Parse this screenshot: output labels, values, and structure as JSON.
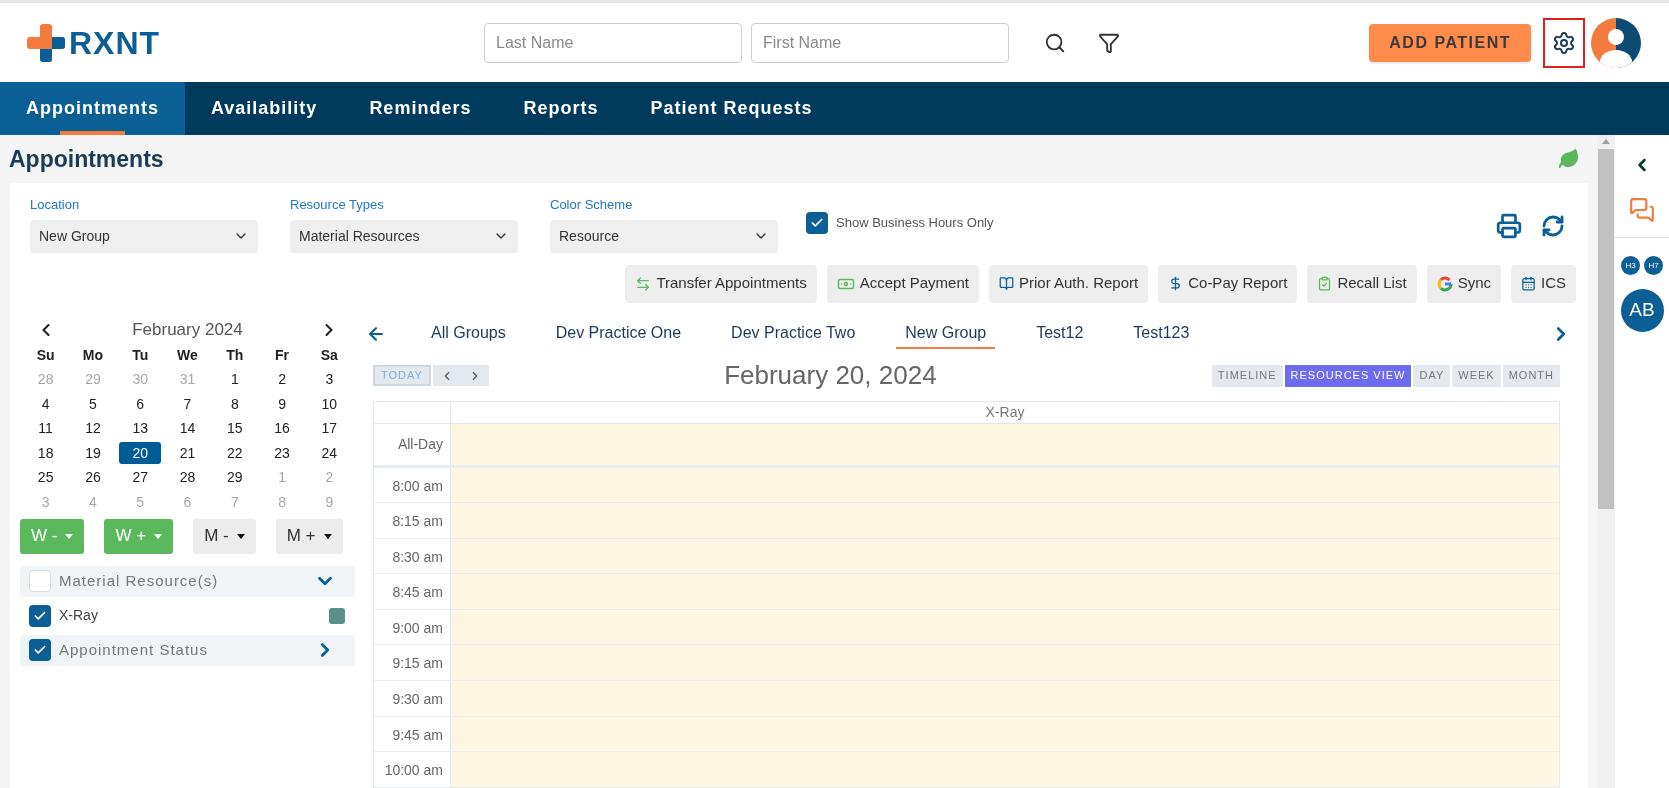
{
  "header": {
    "logo": "RXNT",
    "search_fields": [
      {
        "placeholder": "Last Name"
      },
      {
        "placeholder": "First Name"
      }
    ],
    "add_patient": "ADD PATIENT"
  },
  "nav_tabs": [
    {
      "label": "Appointments",
      "selected": true
    },
    {
      "label": "Availability",
      "selected": false
    },
    {
      "label": "Reminders",
      "selected": false
    },
    {
      "label": "Reports",
      "selected": false
    },
    {
      "label": "Patient Requests",
      "selected": false
    }
  ],
  "page_title": "Appointments",
  "filters": [
    {
      "label": "Location",
      "value": "New Group"
    },
    {
      "label": "Resource Types",
      "value": "Material Resources"
    },
    {
      "label": "Color Scheme",
      "value": "Resource"
    }
  ],
  "business_hours": {
    "label": "Show Business Hours Only",
    "checked": true
  },
  "action_buttons": [
    "Transfer Appointments",
    "Accept Payment",
    "Prior Auth. Report",
    "Co-Pay Report",
    "Recall List",
    "Sync",
    "ICS"
  ],
  "mini_calendar": {
    "month": "February 2024",
    "weekdays": [
      "Su",
      "Mo",
      "Tu",
      "We",
      "Th",
      "Fr",
      "Sa"
    ],
    "weeks": [
      {
        "days": [
          {
            "label": "28",
            "outside": true,
            "selected": false
          },
          {
            "label": "29",
            "outside": true,
            "selected": false
          },
          {
            "label": "30",
            "outside": true,
            "selected": false
          },
          {
            "label": "31",
            "outside": true,
            "selected": false
          },
          {
            "label": "1",
            "outside": false,
            "selected": false
          },
          {
            "label": "2",
            "outside": false,
            "selected": false
          },
          {
            "label": "3",
            "outside": false,
            "selected": false
          }
        ]
      },
      {
        "days": [
          {
            "label": "4",
            "outside": false,
            "selected": false
          },
          {
            "label": "5",
            "outside": false,
            "selected": false
          },
          {
            "label": "6",
            "outside": false,
            "selected": false
          },
          {
            "label": "7",
            "outside": false,
            "selected": false
          },
          {
            "label": "8",
            "outside": false,
            "selected": false
          },
          {
            "label": "9",
            "outside": false,
            "selected": false
          },
          {
            "label": "10",
            "outside": false,
            "selected": false
          }
        ]
      },
      {
        "days": [
          {
            "label": "11",
            "outside": false,
            "selected": false
          },
          {
            "label": "12",
            "outside": false,
            "selected": false
          },
          {
            "label": "13",
            "outside": false,
            "selected": false
          },
          {
            "label": "14",
            "outside": false,
            "selected": false
          },
          {
            "label": "15",
            "outside": false,
            "selected": false
          },
          {
            "label": "16",
            "outside": false,
            "selected": false
          },
          {
            "label": "17",
            "outside": false,
            "selected": false
          }
        ]
      },
      {
        "days": [
          {
            "label": "18",
            "outside": false,
            "selected": false
          },
          {
            "label": "19",
            "outside": false,
            "selected": false
          },
          {
            "label": "20",
            "outside": false,
            "selected": true
          },
          {
            "label": "21",
            "outside": false,
            "selected": false
          },
          {
            "label": "22",
            "outside": false,
            "selected": false
          },
          {
            "label": "23",
            "outside": false,
            "selected": false
          },
          {
            "label": "24",
            "outside": false,
            "selected": false
          }
        ]
      },
      {
        "days": [
          {
            "label": "25",
            "outside": false,
            "selected": false
          },
          {
            "label": "26",
            "outside": false,
            "selected": false
          },
          {
            "label": "27",
            "outside": false,
            "selected": false
          },
          {
            "label": "28",
            "outside": false,
            "selected": false
          },
          {
            "label": "29",
            "outside": false,
            "selected": false
          },
          {
            "label": "1",
            "outside": true,
            "selected": false
          },
          {
            "label": "2",
            "outside": true,
            "selected": false
          }
        ]
      },
      {
        "days": [
          {
            "label": "3",
            "outside": true,
            "selected": false
          },
          {
            "label": "4",
            "outside": true,
            "selected": false
          },
          {
            "label": "5",
            "outside": true,
            "selected": false
          },
          {
            "label": "6",
            "outside": true,
            "selected": false
          },
          {
            "label": "7",
            "outside": true,
            "selected": false
          },
          {
            "label": "8",
            "outside": true,
            "selected": false
          },
          {
            "label": "9",
            "outside": true,
            "selected": false
          }
        ]
      }
    ]
  },
  "range_buttons": [
    {
      "label": "W -",
      "active": true
    },
    {
      "label": "W +",
      "active": true
    },
    {
      "label": "M -",
      "active": false
    },
    {
      "label": "M +",
      "active": false
    }
  ],
  "resource_group": {
    "label": "Material Resource(s)",
    "checked": false,
    "expanded": true,
    "items": [
      {
        "label": "X-Ray",
        "checked": true,
        "color": "#5b8f8a"
      }
    ]
  },
  "status_group": {
    "label": "Appointment Status",
    "checked": true,
    "expanded": false
  },
  "group_tabs": [
    {
      "label": "All Groups",
      "selected": false
    },
    {
      "label": "Dev Practice One",
      "selected": false
    },
    {
      "label": "Dev Practice Two",
      "selected": false
    },
    {
      "label": "New Group",
      "selected": true
    },
    {
      "label": "Test12",
      "selected": false
    },
    {
      "label": "Test123",
      "selected": false
    }
  ],
  "scheduler": {
    "today": "TODAY",
    "date_title": "February 20, 2024",
    "views": [
      {
        "label": "TIMELINE",
        "selected": false
      },
      {
        "label": "RESOURCES VIEW",
        "selected": true
      },
      {
        "label": "DAY",
        "selected": false
      },
      {
        "label": "WEEK",
        "selected": false
      },
      {
        "label": "MONTH",
        "selected": false
      }
    ],
    "column": "X-Ray",
    "all_day": "All-Day",
    "slots": [
      "8:00 am",
      "8:15 am",
      "8:30 am",
      "8:45 am",
      "9:00 am",
      "9:15 am",
      "9:30 am",
      "9:45 am",
      "10:00 am"
    ]
  },
  "side_panel": {
    "badges": [
      "H3",
      "H7"
    ],
    "user_initials": "AB"
  }
}
